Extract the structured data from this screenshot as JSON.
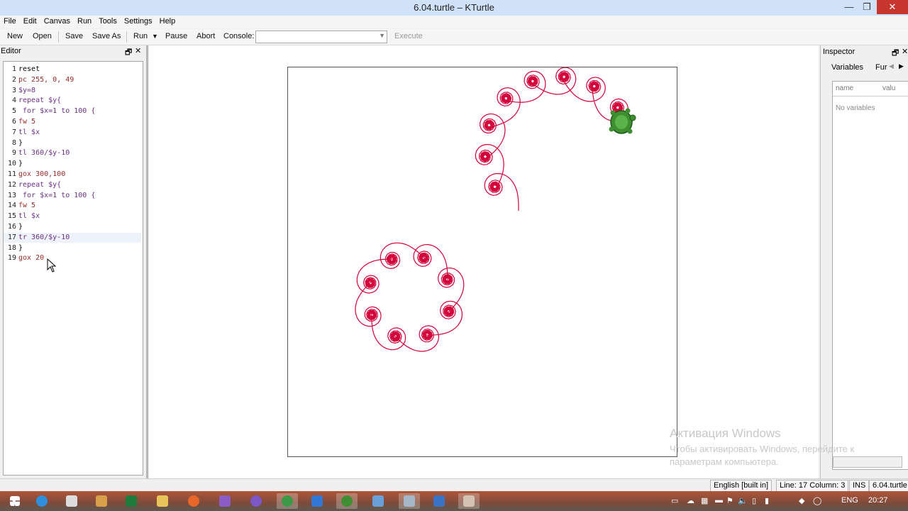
{
  "window": {
    "title": "6.04.turtle – KTurtle",
    "min": "—",
    "max": "❐",
    "close": "✕"
  },
  "menu": [
    "File",
    "Edit",
    "Canvas",
    "Run",
    "Tools",
    "Settings",
    "Help"
  ],
  "toolbar": {
    "new": "New",
    "open": "Open",
    "save": "Save",
    "save_as": "Save As",
    "run": "Run",
    "pause": "Pause",
    "abort": "Abort",
    "console_label": "Console:",
    "console_value": "",
    "execute": "Execute"
  },
  "editor": {
    "title": "Editor",
    "lines": [
      {
        "n": "1",
        "text": "reset"
      },
      {
        "n": "2",
        "text": "pc 255, 0, 49"
      },
      {
        "n": "3",
        "text": "$y=8"
      },
      {
        "n": "4",
        "text": "repeat $y{"
      },
      {
        "n": "5",
        "text": " for $x=1 to 100 {"
      },
      {
        "n": "6",
        "text": "fw 5"
      },
      {
        "n": "7",
        "text": "tl $x"
      },
      {
        "n": "8",
        "text": "}"
      },
      {
        "n": "9",
        "text": "tl 360/$y-10"
      },
      {
        "n": "10",
        "text": "}"
      },
      {
        "n": "11",
        "text": "gox 300,100"
      },
      {
        "n": "12",
        "text": "repeat $y{"
      },
      {
        "n": "13",
        "text": " for $x=1 to 100 {"
      },
      {
        "n": "14",
        "text": "fw 5"
      },
      {
        "n": "15",
        "text": "tl $x"
      },
      {
        "n": "16",
        "text": "}"
      },
      {
        "n": "17",
        "text": "tr 360/$y-10"
      },
      {
        "n": "18",
        "text": "}"
      },
      {
        "n": "19",
        "text": "gox 20"
      }
    ],
    "current_line": 17
  },
  "canvas": {
    "pen_color": "#d4003a",
    "pen_rgb": "255, 0, 49"
  },
  "inspector": {
    "title": "Inspector",
    "tabs": [
      "Variables",
      "Fur"
    ],
    "col_name": "name",
    "col_value": "valu",
    "empty_text": "No variables"
  },
  "status": {
    "language": "English [built in]",
    "position": "Line: 17 Column: 3",
    "mode": "INS",
    "file": "6.04.turtle"
  },
  "watermark": {
    "line1": "Активация Windows",
    "line2": "Чтобы активировать Windows, перейдите к",
    "line3": "параметрам компьютера."
  },
  "tray": {
    "lang": "ENG",
    "time": "20:27"
  }
}
